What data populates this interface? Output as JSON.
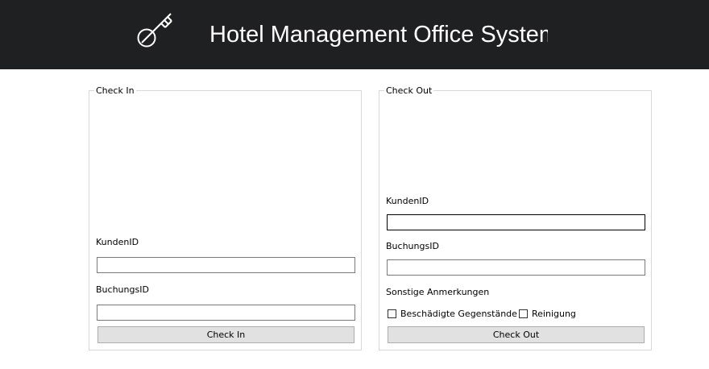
{
  "header": {
    "title": "Hotel Management Office System",
    "logo_icon": "key-icon",
    "background": "#1f2021"
  },
  "checkin": {
    "group_title": "Check In",
    "kunden_label": "KundenID",
    "kunden_value": "",
    "buchung_label": "BuchungsID",
    "buchung_value": "",
    "button_label": "Check In"
  },
  "checkout": {
    "group_title": "Check Out",
    "kunden_label": "KundenID",
    "kunden_value": "",
    "buchung_label": "BuchungsID",
    "buchung_value": "",
    "notes_label": "Sonstige Anmerkungen",
    "damaged_label": "Beschädigte Gegenstände",
    "cleaning_label": "Reinigung",
    "button_label": "Check Out"
  }
}
